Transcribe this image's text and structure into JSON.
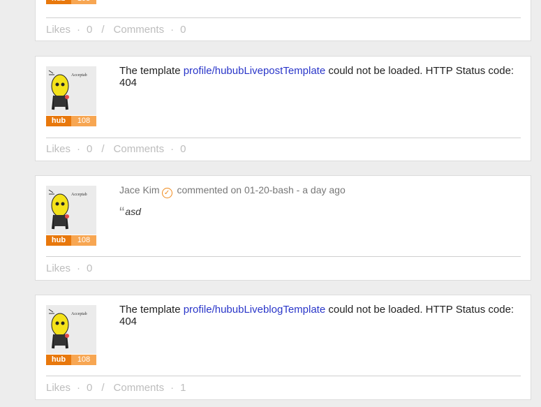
{
  "badge": {
    "hub": "hub",
    "count": "108"
  },
  "footer": {
    "likes_label": "Likes",
    "comments_label": "Comments",
    "dot": "·",
    "slash": "/"
  },
  "posts": [
    {
      "likes": "0",
      "comments": "0"
    },
    {
      "text_before": "The template ",
      "link": "profile/hububLivepostTemplate",
      "text_after": " could not be loaded. HTTP Status code: 404",
      "likes": "0",
      "comments": "0"
    },
    {
      "author": "Jace Kim",
      "action": " commented on 01-20-bash - a day ago",
      "quote_mark": "“",
      "quote": "asd",
      "likes": "0"
    },
    {
      "text_before": "The template ",
      "link": "profile/hububLiveblogTemplate",
      "text_after": " could not be loaded. HTTP Status code: 404",
      "likes": "0",
      "comments": "1"
    }
  ],
  "avatar_caption": "Acceptab"
}
